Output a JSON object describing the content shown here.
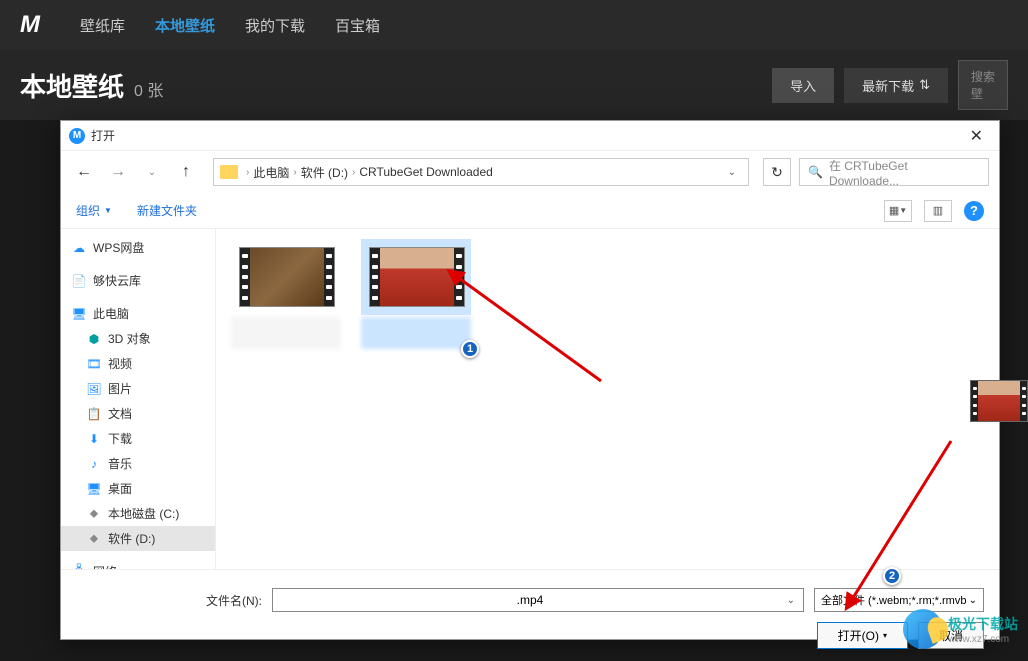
{
  "header": {
    "logo": "M",
    "tabs": [
      {
        "label": "壁纸库",
        "active": false
      },
      {
        "label": "本地壁纸",
        "active": true
      },
      {
        "label": "我的下载",
        "active": false
      },
      {
        "label": "百宝箱",
        "active": false
      }
    ]
  },
  "subheader": {
    "title": "本地壁纸",
    "count": "0 张",
    "import_btn": "导入",
    "download_btn": "最新下载",
    "search_placeholder": "搜索壁"
  },
  "dialog": {
    "title": "打开",
    "breadcrumb": [
      "此电脑",
      "软件 (D:)",
      "CRTubeGet Downloaded"
    ],
    "search_placeholder": "在 CRTubeGet Downloade...",
    "toolbar": {
      "organize": "组织",
      "new_folder": "新建文件夹"
    },
    "sidebar": [
      {
        "label": "WPS网盘",
        "icon": "cloud",
        "indent": 0
      },
      {
        "label": "够快云库",
        "icon": "doc",
        "indent": 0
      },
      {
        "label": "此电脑",
        "icon": "pc",
        "indent": 0
      },
      {
        "label": "3D 对象",
        "icon": "3d",
        "indent": 1
      },
      {
        "label": "视频",
        "icon": "video",
        "indent": 1
      },
      {
        "label": "图片",
        "icon": "image",
        "indent": 1
      },
      {
        "label": "文档",
        "icon": "docs",
        "indent": 1
      },
      {
        "label": "下载",
        "icon": "download",
        "indent": 1
      },
      {
        "label": "音乐",
        "icon": "music",
        "indent": 1
      },
      {
        "label": "桌面",
        "icon": "desktop",
        "indent": 1
      },
      {
        "label": "本地磁盘 (C:)",
        "icon": "disk",
        "indent": 1
      },
      {
        "label": "软件 (D:)",
        "icon": "disk",
        "indent": 1,
        "selected": true
      },
      {
        "label": "网络",
        "icon": "network",
        "indent": 0
      }
    ],
    "filename_label": "文件名(N):",
    "filename_value": ".mp4",
    "filetype": "全部文件 (*.webm;*.rm;*.rmvb",
    "open_btn": "打开(O)",
    "cancel_btn": "取消"
  },
  "annotations": {
    "badge1": "1",
    "badge2": "2"
  },
  "watermark": {
    "name": "极光下载站",
    "url": "www.xz7.com"
  }
}
